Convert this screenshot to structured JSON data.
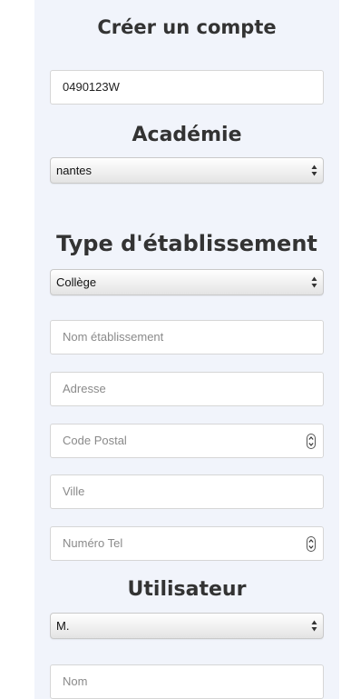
{
  "header": {
    "title": "Créer un compte"
  },
  "account": {
    "uai_value": "0490123W"
  },
  "academie": {
    "heading": "Académie",
    "selected": "nantes"
  },
  "etablissement": {
    "heading": "Type d'établissement",
    "type_selected": "Collège",
    "nom_placeholder": "Nom établissement",
    "adresse_placeholder": "Adresse",
    "code_postal_placeholder": "Code Postal",
    "ville_placeholder": "Ville",
    "telephone_placeholder": "Numéro Tel"
  },
  "utilisateur": {
    "heading": "Utilisateur",
    "civilite_selected": "M.",
    "nom_placeholder": "Nom"
  }
}
